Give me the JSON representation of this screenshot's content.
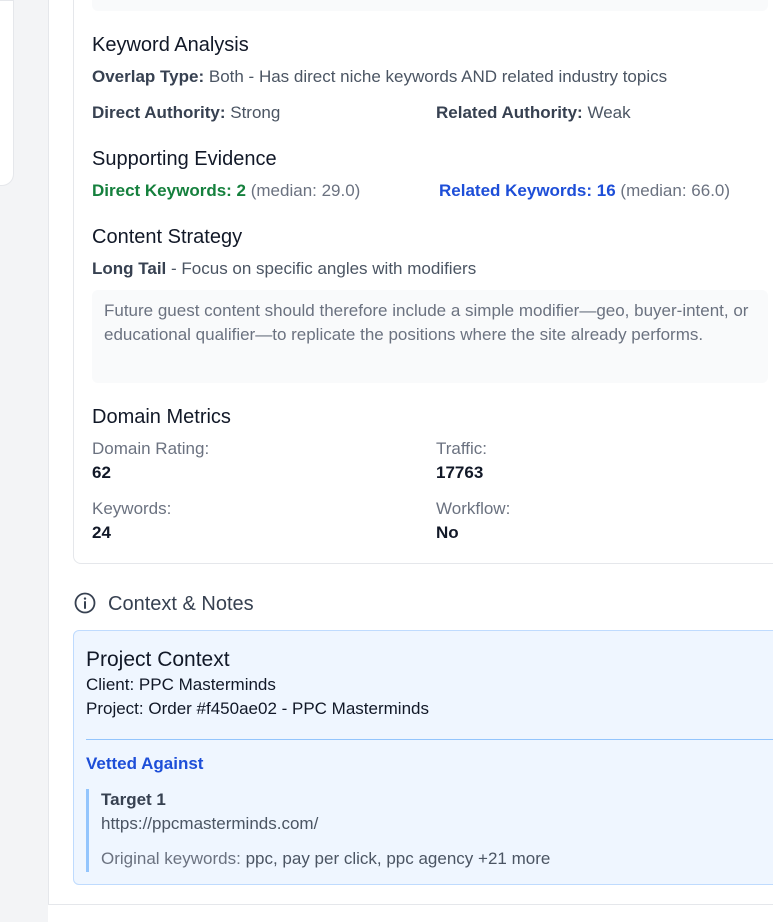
{
  "keyword_analysis": {
    "title": "Keyword Analysis",
    "overlap_label": "Overlap Type:",
    "overlap_value": "Both - Has direct niche keywords AND related industry topics",
    "direct_authority_label": "Direct Authority:",
    "direct_authority_value": "Strong",
    "related_authority_label": "Related Authority:",
    "related_authority_value": "Weak"
  },
  "supporting_evidence": {
    "title": "Supporting Evidence",
    "direct_keywords": "Direct Keywords: 2",
    "direct_median": "(median: 29.0)",
    "related_keywords": "Related Keywords: 16",
    "related_median": "(median: 66.0)"
  },
  "content_strategy": {
    "title": "Content Strategy",
    "type": "Long Tail",
    "description": " - Focus on specific angles with modifiers",
    "note": "Future guest content should therefore include a simple modifier—geo, buyer-intent, or educational qualifier—to replicate the positions where the site already performs."
  },
  "domain_metrics": {
    "title": "Domain Metrics",
    "domain_rating_label": "Domain Rating:",
    "domain_rating_value": "62",
    "traffic_label": "Traffic:",
    "traffic_value": "17763",
    "keywords_label": "Keywords:",
    "keywords_value": "24",
    "workflow_label": "Workflow:",
    "workflow_value": "No"
  },
  "context_notes": {
    "title": "Context & Notes",
    "icon": "info-circle-icon",
    "project_context_title": "Project Context",
    "client_line": "Client: PPC Masterminds",
    "project_line": "Project: Order #f450ae02 - PPC Masterminds",
    "vetted_against": "Vetted Against",
    "target": {
      "name": "Target 1",
      "url": "https://ppcmasterminds.com/",
      "keywords_label": "Original keywords: ",
      "keywords_value": "ppc, pay per click, ppc agency +21 more"
    }
  },
  "colors": {
    "direct_green": "#15803d",
    "related_blue": "#1d4ed8",
    "context_bg": "#eff6ff",
    "context_border": "#bfdbfe"
  }
}
